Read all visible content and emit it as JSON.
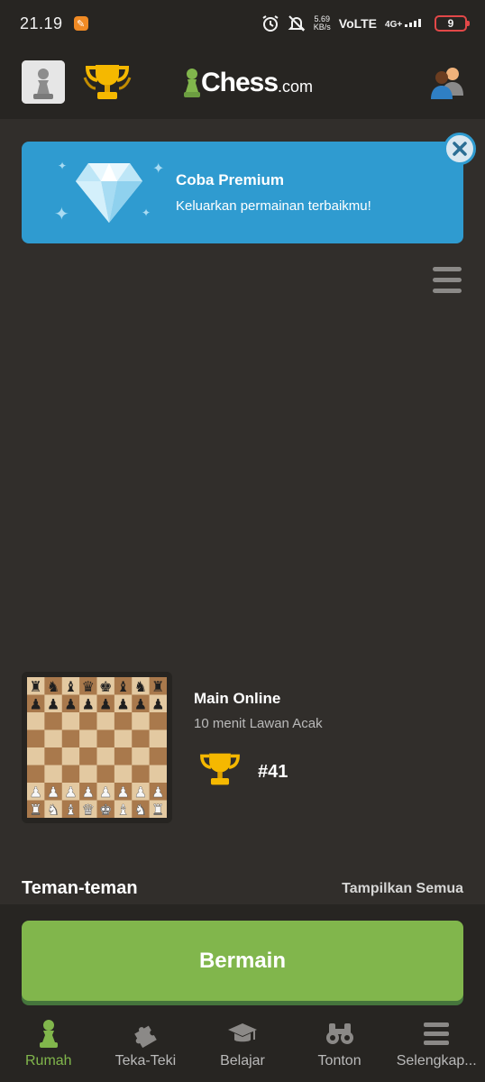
{
  "status_bar": {
    "time": "21.19",
    "speed_value": "5.69",
    "speed_unit": "KB/s",
    "volte": "VoLTE",
    "network": "4G+",
    "battery": "9"
  },
  "header": {
    "logo_text": "Chess",
    "logo_suffix": ".com",
    "avatar_icon": "pawn-avatar-icon",
    "trophy_icon": "trophy-icon",
    "friends_icon": "friends-icon"
  },
  "premium": {
    "title": "Coba Premium",
    "subtitle": "Keluarkan permainan terbaikmu!",
    "icon": "diamond-icon",
    "close_icon": "close-icon",
    "color": "#2f9bd0"
  },
  "main": {
    "menu_icon": "hamburger-menu-icon"
  },
  "play_online": {
    "title": "Main Online",
    "subtitle": "10 menit Lawan Acak",
    "rank": "#41"
  },
  "friends": {
    "title": "Teman-teman",
    "show_all": "Tampilkan Semua"
  },
  "play_button": {
    "label": "Bermain",
    "color": "#81b64c"
  },
  "nav": {
    "items": [
      {
        "label": "Rumah",
        "icon": "pawn-icon",
        "active": true
      },
      {
        "label": "Teka-Teki",
        "icon": "puzzle-icon",
        "active": false
      },
      {
        "label": "Belajar",
        "icon": "graduation-cap-icon",
        "active": false
      },
      {
        "label": "Tonton",
        "icon": "binoculars-icon",
        "active": false
      },
      {
        "label": "Selengkap...",
        "icon": "menu-icon",
        "active": false
      }
    ]
  }
}
